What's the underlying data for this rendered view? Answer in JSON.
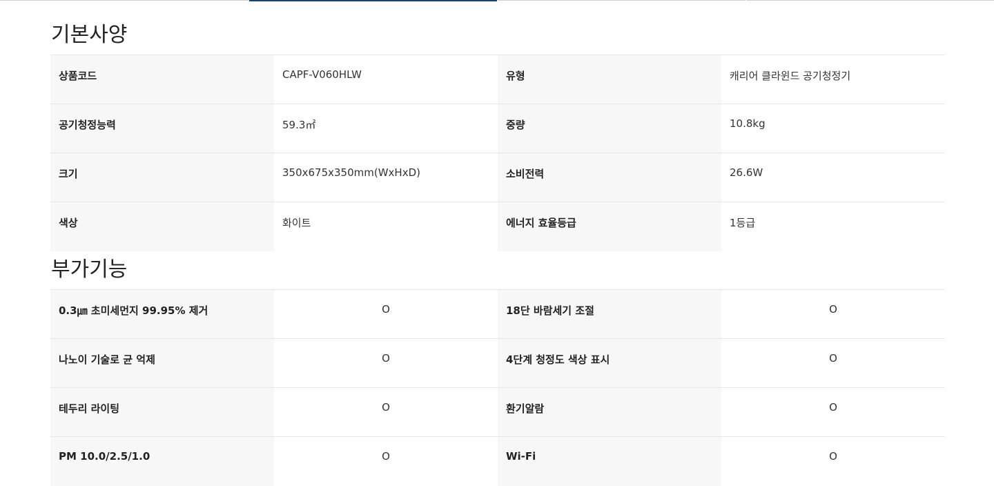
{
  "basic": {
    "title": "기본사양",
    "rows": [
      [
        {
          "label": "상품코드",
          "value": "CAPF-V060HLW"
        },
        {
          "label": "유형",
          "value": "캐리어 클라윈드 공기청정기"
        }
      ],
      [
        {
          "label": "공기청정능력",
          "value": "59.3㎡"
        },
        {
          "label": "중량",
          "value": "10.8kg"
        }
      ],
      [
        {
          "label": "크기",
          "value": "350x675x350mm(WxHxD)"
        },
        {
          "label": "소비전력",
          "value": "26.6W"
        }
      ],
      [
        {
          "label": "색상",
          "value": "화이트"
        },
        {
          "label": "에너지 효율등급",
          "value": "1등급"
        }
      ]
    ]
  },
  "extra": {
    "title": "부가기능",
    "rows": [
      [
        {
          "label": "0.3㎛ 초미세먼지 99.95% 제거",
          "value": "O"
        },
        {
          "label": "18단 바람세기 조절",
          "value": "O"
        }
      ],
      [
        {
          "label": "나노이 기술로 균 억제",
          "value": "O"
        },
        {
          "label": "4단계 청정도 색상 표시",
          "value": "O"
        }
      ],
      [
        {
          "label": "테두리 라이팅",
          "value": "O"
        },
        {
          "label": "환기알람",
          "value": "O"
        }
      ],
      [
        {
          "label": "PM 10.0/2.5/1.0",
          "value": "O"
        },
        {
          "label": "Wi-Fi",
          "value": "O"
        }
      ]
    ]
  }
}
